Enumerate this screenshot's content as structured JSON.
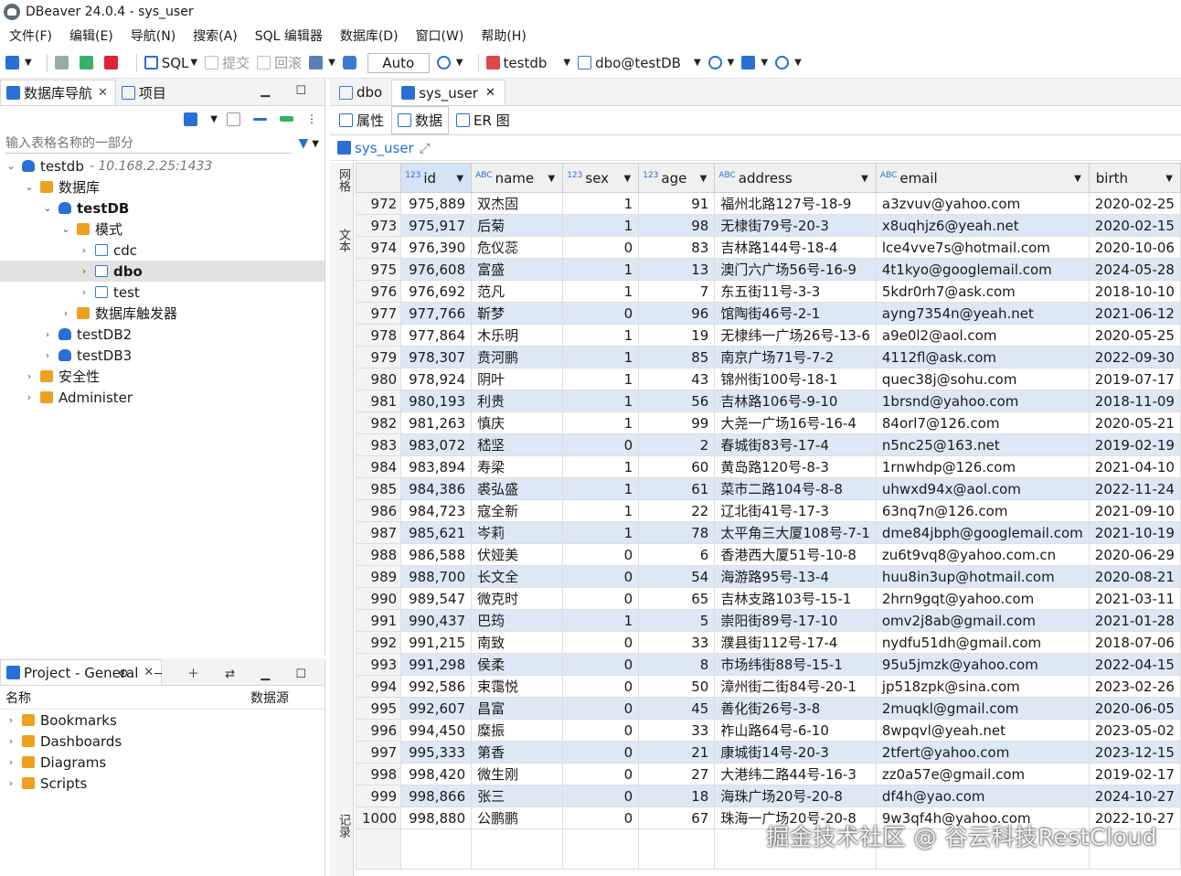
{
  "window": {
    "title": "DBeaver 24.0.4 - sys_user"
  },
  "menu": [
    "文件(F)",
    "编辑(E)",
    "导航(N)",
    "搜索(A)",
    "SQL 编辑器",
    "数据库(D)",
    "窗口(W)",
    "帮助(H)"
  ],
  "toolbar": {
    "sql": "SQL",
    "commit": "提交",
    "rollback": "回滚",
    "mode": "Auto",
    "datasource": "testdb",
    "schema": "dbo@testDB"
  },
  "navigator": {
    "tab_label": "数据库导航",
    "project_tab": "项目",
    "filter_placeholder": "输入表格名称的一部分",
    "tree": [
      {
        "label": "testdb",
        "detail": "- 10.168.2.25:1433",
        "indent": 0,
        "twisty": "v",
        "icon": "connection-icon"
      },
      {
        "label": "数据库",
        "indent": 1,
        "twisty": "v",
        "icon": "folder-icon"
      },
      {
        "label": "testDB",
        "indent": 2,
        "twisty": "v",
        "icon": "database-icon",
        "bold": true
      },
      {
        "label": "模式",
        "indent": 3,
        "twisty": "v",
        "icon": "folder-icon"
      },
      {
        "label": "cdc",
        "indent": 4,
        "twisty": ">",
        "icon": "schema-icon"
      },
      {
        "label": "dbo",
        "indent": 4,
        "twisty": ">",
        "icon": "schema-icon",
        "bold": true,
        "selected": true
      },
      {
        "label": "test",
        "indent": 4,
        "twisty": ">",
        "icon": "schema-icon"
      },
      {
        "label": "数据库触发器",
        "indent": 3,
        "twisty": ">",
        "icon": "folder-icon"
      },
      {
        "label": "testDB2",
        "indent": 2,
        "twisty": ">",
        "icon": "database-icon"
      },
      {
        "label": "testDB3",
        "indent": 2,
        "twisty": ">",
        "icon": "database-icon"
      },
      {
        "label": "安全性",
        "indent": 1,
        "twisty": ">",
        "icon": "folder-icon"
      },
      {
        "label": "Administer",
        "indent": 1,
        "twisty": ">",
        "icon": "folder-icon"
      }
    ]
  },
  "project": {
    "tab_label": "Project - General",
    "col_name": "名称",
    "col_datasource": "数据源",
    "items": [
      "Bookmarks",
      "Dashboards",
      "Diagrams",
      "Scripts"
    ]
  },
  "editor": {
    "tabs": [
      "dbo",
      "sys_user"
    ],
    "subtabs": [
      "属性",
      "数据",
      "ER 图"
    ],
    "query_label": "sys_user",
    "side_labels": {
      "grid": "网格",
      "text": "文本",
      "record": "记录"
    },
    "columns": [
      {
        "type": "123",
        "name": "id"
      },
      {
        "type": "ABC",
        "name": "name"
      },
      {
        "type": "123",
        "name": "sex"
      },
      {
        "type": "123",
        "name": "age"
      },
      {
        "type": "ABC",
        "name": "address"
      },
      {
        "type": "ABC",
        "name": "email"
      },
      {
        "type": "",
        "name": "birth"
      }
    ],
    "rows": [
      [
        "972",
        "975,889",
        "双杰固",
        "1",
        "91",
        "福州北路127号-18-9",
        "a3zvuv@yahoo.com",
        "2020-02-25"
      ],
      [
        "973",
        "975,917",
        "后菊",
        "1",
        "98",
        "无棣街79号-20-3",
        "x8uqhjz6@yeah.net",
        "2020-02-15"
      ],
      [
        "974",
        "976,390",
        "危仪蕊",
        "0",
        "83",
        "吉林路144号-18-4",
        "lce4vve7s@hotmail.com",
        "2020-10-06"
      ],
      [
        "975",
        "976,608",
        "富盛",
        "1",
        "13",
        "澳门六广场56号-16-9",
        "4t1kyo@googlemail.com",
        "2024-05-28"
      ],
      [
        "976",
        "976,692",
        "范凡",
        "1",
        "7",
        "东五街11号-3-3",
        "5kdr0rh7@ask.com",
        "2018-10-10"
      ],
      [
        "977",
        "977,766",
        "靳梦",
        "0",
        "96",
        "馆陶街46号-2-1",
        "ayng7354n@yeah.net",
        "2021-06-12"
      ],
      [
        "978",
        "977,864",
        "木乐明",
        "1",
        "19",
        "无棣纬一广场26号-13-6",
        "a9e0l2@aol.com",
        "2020-05-25"
      ],
      [
        "979",
        "978,307",
        "贲河鹏",
        "1",
        "85",
        "南京广场71号-7-2",
        "4112fl@ask.com",
        "2022-09-30"
      ],
      [
        "980",
        "978,924",
        "阴叶",
        "1",
        "43",
        "锦州街100号-18-1",
        "quec38j@sohu.com",
        "2019-07-17"
      ],
      [
        "981",
        "980,193",
        "利贵",
        "1",
        "56",
        "吉林路106号-9-10",
        "1brsnd@yahoo.com",
        "2018-11-09"
      ],
      [
        "982",
        "981,263",
        "慎庆",
        "1",
        "99",
        "大尧一广场16号-16-4",
        "84orl7@126.com",
        "2020-05-21"
      ],
      [
        "983",
        "983,072",
        "嵇坚",
        "0",
        "2",
        "春城街83号-17-4",
        "n5nc25@163.net",
        "2019-02-19"
      ],
      [
        "984",
        "983,894",
        "寿梁",
        "1",
        "60",
        "黄岛路120号-8-3",
        "1rnwhdp@126.com",
        "2021-04-10"
      ],
      [
        "985",
        "984,386",
        "裘弘盛",
        "1",
        "61",
        "菜市二路104号-8-8",
        "uhwxd94x@aol.com",
        "2022-11-24"
      ],
      [
        "986",
        "984,723",
        "寇全新",
        "1",
        "22",
        "辽北街41号-17-3",
        "63nq7n@126.com",
        "2021-09-10"
      ],
      [
        "987",
        "985,621",
        "岑莉",
        "1",
        "78",
        "太平角三大厦108号-7-1",
        "dme84jbph@googlemail.com",
        "2021-10-19"
      ],
      [
        "988",
        "986,588",
        "伏娅美",
        "0",
        "6",
        "香港西大厦51号-10-8",
        "zu6t9vq8@yahoo.com.cn",
        "2020-06-29"
      ],
      [
        "989",
        "988,700",
        "长文全",
        "0",
        "54",
        "海游路95号-13-4",
        "huu8in3up@hotmail.com",
        "2020-08-21"
      ],
      [
        "990",
        "989,547",
        "微克时",
        "0",
        "65",
        "吉林支路103号-15-1",
        "2hrn9gqt@yahoo.com",
        "2021-03-11"
      ],
      [
        "991",
        "990,437",
        "巴筠",
        "1",
        "5",
        "崇阳街89号-17-10",
        "omv2j8ab@gmail.com",
        "2021-01-28"
      ],
      [
        "992",
        "991,215",
        "南致",
        "0",
        "33",
        "濮县街112号-17-4",
        "nydfu51dh@gmail.com",
        "2018-07-06"
      ],
      [
        "993",
        "991,298",
        "侯柔",
        "0",
        "8",
        "市场纬街88号-15-1",
        "95u5jmzk@yahoo.com",
        "2022-04-15"
      ],
      [
        "994",
        "992,586",
        "束霭悦",
        "0",
        "50",
        "漳州街二街84号-20-1",
        "jp518zpk@sina.com",
        "2023-02-26"
      ],
      [
        "995",
        "992,607",
        "昌富",
        "0",
        "45",
        "善化街26号-3-8",
        "2muqkl@gmail.com",
        "2020-06-05"
      ],
      [
        "996",
        "994,450",
        "糜振",
        "0",
        "33",
        "祚山路64号-6-10",
        "8wpqvl@yeah.net",
        "2023-05-02"
      ],
      [
        "997",
        "995,333",
        "第香",
        "0",
        "21",
        "康城街14号-20-3",
        "2tfert@yahoo.com",
        "2023-12-15"
      ],
      [
        "998",
        "998,420",
        "微生刚",
        "0",
        "27",
        "大港纬二路44号-16-3",
        "zz0a57e@gmail.com",
        "2019-02-17"
      ],
      [
        "999",
        "998,866",
        "张三",
        "0",
        "18",
        "海珠广场20号-20-8",
        "df4h@yao.com",
        "2024-10-27"
      ],
      [
        "1000",
        "998,880",
        "公鹏鹏",
        "0",
        "67",
        "珠海一广场20号-20-8",
        "9w3qf4h@yahoo.com",
        "2022-10-27"
      ]
    ]
  },
  "watermark": "掘金技术社区 @ 谷云科技RestCloud"
}
